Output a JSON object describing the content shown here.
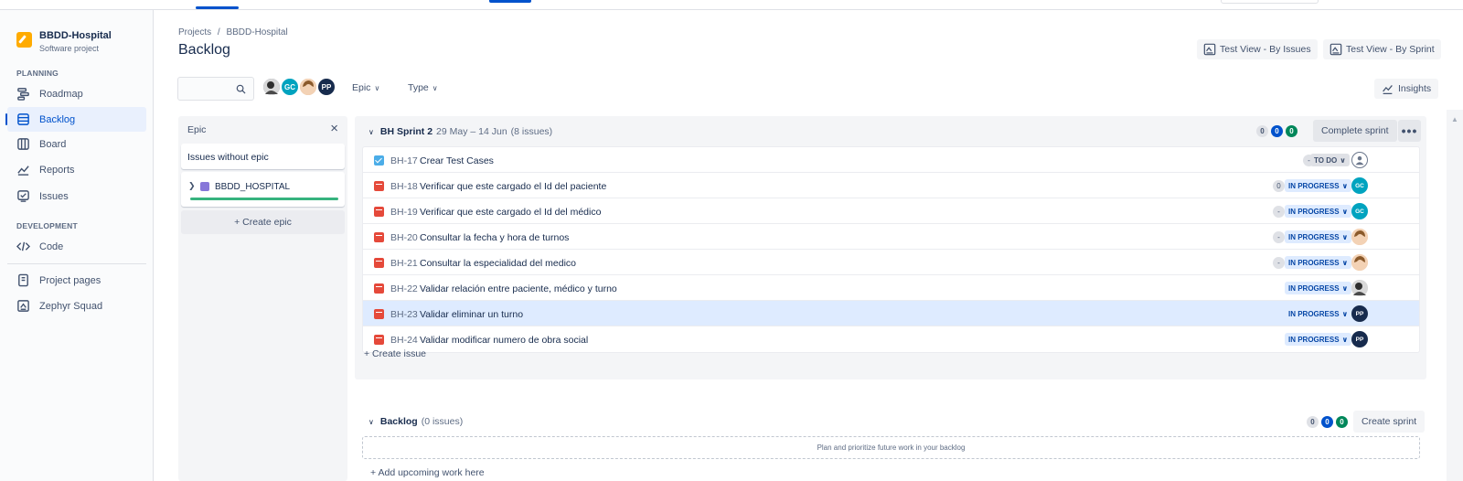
{
  "project": {
    "name": "BBDD-Hospital",
    "type": "Software project"
  },
  "sidebar": {
    "planning_label": "PLANNING",
    "development_label": "DEVELOPMENT",
    "items": [
      {
        "label": "Roadmap",
        "icon": "roadmap-icon"
      },
      {
        "label": "Backlog",
        "icon": "backlog-icon",
        "active": true
      },
      {
        "label": "Board",
        "icon": "board-icon"
      },
      {
        "label": "Reports",
        "icon": "reports-icon"
      },
      {
        "label": "Issues",
        "icon": "issues-icon"
      },
      {
        "label": "Code",
        "icon": "code-icon"
      },
      {
        "label": "Project pages",
        "icon": "pages-icon"
      },
      {
        "label": "Zephyr Squad",
        "icon": "zephyr-icon"
      }
    ]
  },
  "header": {
    "breadcrumb_projects": "Projects",
    "breadcrumb_sep": "/",
    "breadcrumb_project": "BBDD-Hospital",
    "title": "Backlog",
    "btn_test_by_issues": "Test View - By Issues",
    "btn_test_by_sprint": "Test View - By Sprint"
  },
  "toolbar": {
    "search_placeholder": "",
    "avatars": [
      "",
      "GC",
      "",
      "PP"
    ],
    "filter_epic": "Epic",
    "filter_type": "Type",
    "insights": "Insights"
  },
  "epic_panel": {
    "title": "Epic",
    "close": "×",
    "issues_without_epic": "Issues without epic",
    "epic_name": "BBDD_HOSPITAL",
    "create_epic": "+ Create epic"
  },
  "sprint": {
    "name": "BH Sprint 2",
    "dates": "29 May – 14 Jun",
    "count": "(8 issues)",
    "counts": [
      "0",
      "0",
      "0"
    ],
    "complete_btn": "Complete sprint",
    "more": "•••",
    "create_issue": "+ Create issue",
    "issues": [
      {
        "key": "BH-17",
        "summary": "Crear Test Cases",
        "type": "task",
        "estimate": "-",
        "status": "TO DO",
        "assignee": ""
      },
      {
        "key": "BH-18",
        "summary": "Verificar que este cargado el Id del paciente",
        "type": "bug",
        "estimate": "0",
        "status": "IN PROGRESS",
        "assignee": "GC"
      },
      {
        "key": "BH-19",
        "summary": "Verificar que este cargado el Id del médico",
        "type": "bug",
        "estimate": "-",
        "status": "IN PROGRESS",
        "assignee": "GC"
      },
      {
        "key": "BH-20",
        "summary": "Consultar la fecha y hora de turnos",
        "type": "bug",
        "estimate": "-",
        "status": "IN PROGRESS",
        "assignee": ""
      },
      {
        "key": "BH-21",
        "summary": "Consultar la especialidad del medico",
        "type": "bug",
        "estimate": "-",
        "status": "IN PROGRESS",
        "assignee": ""
      },
      {
        "key": "BH-22",
        "summary": "Validar relación entre paciente, médico y turno",
        "type": "bug",
        "estimate": "",
        "status": "IN PROGRESS",
        "assignee": ""
      },
      {
        "key": "BH-23",
        "summary": "Validar eliminar un turno",
        "type": "bug",
        "estimate": "",
        "status": "IN PROGRESS",
        "assignee": "PP"
      },
      {
        "key": "BH-24",
        "summary": "Validar modificar numero de obra social",
        "type": "bug",
        "estimate": "",
        "status": "IN PROGRESS",
        "assignee": "PP"
      }
    ]
  },
  "backlog": {
    "name": "Backlog",
    "count": "(0 issues)",
    "counts": [
      "0",
      "0",
      "0"
    ],
    "create_sprint": "Create sprint",
    "empty_text": "Plan and prioritize future work in your backlog",
    "add_upcoming": "+ Add upcoming work here"
  },
  "colors": {
    "accent": "#0052CC",
    "done": "#00875A",
    "gc_avatar": "#00A3BF",
    "pp_avatar": "#172B4D"
  }
}
